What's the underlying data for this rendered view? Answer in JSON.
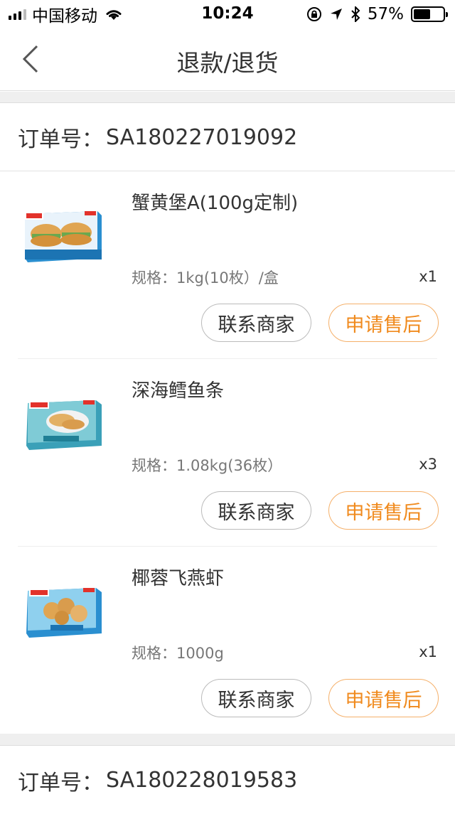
{
  "status_bar": {
    "carrier": "中国移动",
    "time": "10:24",
    "battery": "57%",
    "battery_level": 0.57,
    "icons": [
      "signal-icon",
      "wifi-icon",
      "orientation-lock-icon",
      "location-icon",
      "bluetooth-icon",
      "battery-icon"
    ]
  },
  "nav": {
    "title": "退款/退货",
    "back_icon": "chevron-left-icon"
  },
  "orders": [
    {
      "order_label": "订单号：",
      "order_no": "SA180227019092",
      "items": [
        {
          "name": "蟹黄堡A(100g定制)",
          "spec": "规格：1kg(10枚）/盒",
          "qty": "x1",
          "contact_label": "联系商家",
          "after_sale_label": "申请售后",
          "thumb_icon": "crab-burger-package-image"
        },
        {
          "name": "深海鳕鱼条",
          "spec": "规格：1.08kg(36枚）",
          "qty": "x3",
          "contact_label": "联系商家",
          "after_sale_label": "申请售后",
          "thumb_icon": "cod-fish-strips-package-image"
        },
        {
          "name": "椰蓉飞燕虾",
          "spec": "规格：1000g",
          "qty": "x1",
          "contact_label": "联系商家",
          "after_sale_label": "申请售后",
          "thumb_icon": "coconut-shrimp-package-image"
        }
      ]
    },
    {
      "order_label": "订单号：",
      "order_no": "SA180228019583",
      "items": []
    }
  ],
  "colors": {
    "accent": "#f08a1d",
    "accent_border": "#f5b06a",
    "text": "#333333",
    "subtext": "#777777",
    "divider_bg": "#efefef"
  }
}
